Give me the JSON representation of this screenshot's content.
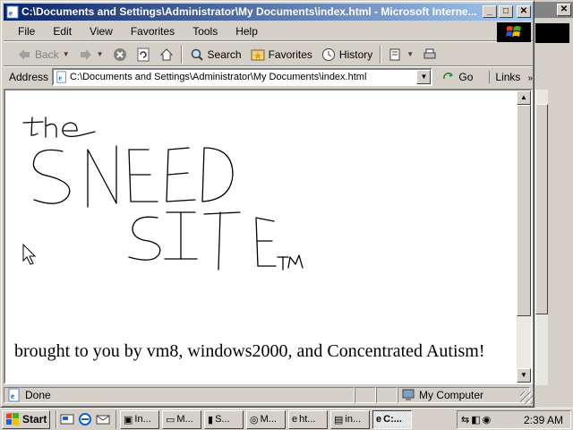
{
  "window": {
    "title": "C:\\Documents and Settings\\Administrator\\My Documents\\index.html - Microsoft Interne...",
    "controls": [
      "_",
      "□",
      "✕"
    ]
  },
  "menubar": {
    "items": [
      "File",
      "Edit",
      "View",
      "Favorites",
      "Tools",
      "Help"
    ]
  },
  "toolbar": {
    "back_label": "Back",
    "search_label": "Search",
    "favorites_label": "Favorites",
    "history_label": "History"
  },
  "address": {
    "label": "Address",
    "value": "C:\\Documents and Settings\\Administrator\\My Documents\\index.html",
    "go_label": "Go",
    "links_label": "Links"
  },
  "page": {
    "drawn_title_line1": "the",
    "drawn_title_line2": "SNEED",
    "drawn_title_line3": "SITE",
    "drawn_tm": "TM",
    "tagline": "brought to you by vm8, windows2000, and Concentrated Autism!"
  },
  "statusbar": {
    "status": "Done",
    "zone": "My Computer"
  },
  "taskbar": {
    "start_label": "Start",
    "tasks": [
      "In...",
      "M...",
      "S...",
      "M...",
      "ht...",
      "in...",
      "C:..."
    ],
    "clock": "2:39 AM"
  },
  "colors": {
    "title_active": "#0a246a",
    "title_gradient_end": "#a6caf0",
    "chrome": "#d4d0c8"
  },
  "icons": [
    "ie-page-icon",
    "back-arrow-icon",
    "forward-arrow-icon",
    "stop-icon",
    "refresh-icon",
    "home-icon",
    "search-icon",
    "favorites-icon",
    "history-icon",
    "mail-icon",
    "print-icon",
    "go-arrow-icon",
    "computer-icon",
    "windows-logo-icon"
  ]
}
